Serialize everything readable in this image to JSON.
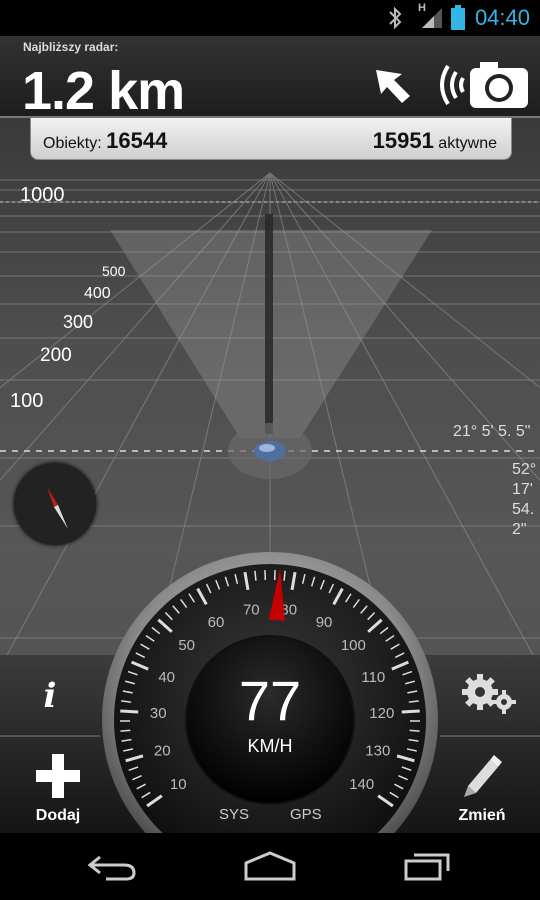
{
  "status_bar": {
    "time": "04:40",
    "icons": [
      "bluetooth-icon",
      "signal-icon",
      "battery-icon"
    ],
    "network_label": "H"
  },
  "header": {
    "label": "Najbliższy radar:",
    "distance": "1.2 km",
    "icons": [
      "direction-arrow-icon",
      "speed-camera-icon"
    ]
  },
  "info_bar": {
    "objects_label": "Obiekty:",
    "objects_count": "16544",
    "active_count": "15951",
    "active_label": "aktywne"
  },
  "radar": {
    "distance_labels": [
      "1000",
      "500",
      "400",
      "300",
      "200",
      "100"
    ],
    "coordinates": {
      "longitude": "21° 5' 5. 5\"",
      "latitude_lines": [
        "52°",
        "17'",
        "54.",
        "2\""
      ]
    }
  },
  "speedometer": {
    "speed": "77",
    "unit": "KM/H",
    "speed_value": 77,
    "scale_labels": [
      "10",
      "20",
      "30",
      "40",
      "50",
      "60",
      "70",
      "80",
      "90",
      "100",
      "110",
      "120",
      "130",
      "140"
    ],
    "sys_label": "SYS",
    "gps_label": "GPS"
  },
  "buttons": {
    "info": "i",
    "add_label": "Dodaj",
    "settings_icon": "gears-icon",
    "change_label": "Zmień"
  },
  "nav_bar": {
    "icons": [
      "back-icon",
      "home-icon",
      "recents-icon"
    ]
  },
  "colors": {
    "accent_blue": "#33b5e5",
    "needle_red": "#c40000"
  }
}
